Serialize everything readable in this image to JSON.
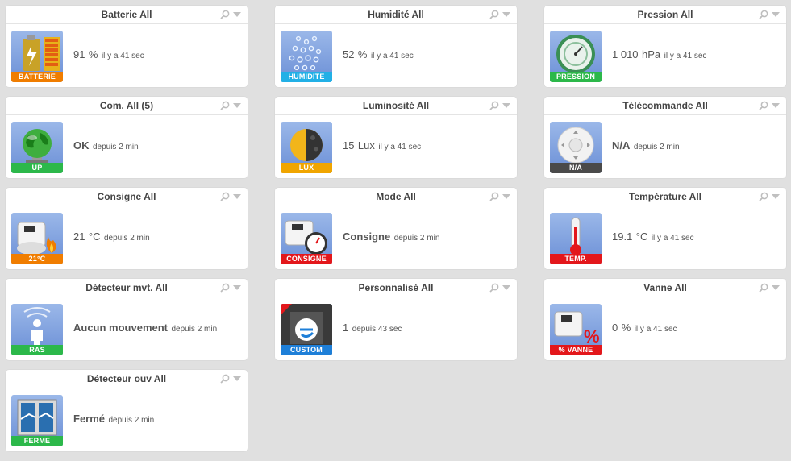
{
  "cards": [
    {
      "title": "Batterie All",
      "icon": "battery-icon",
      "label": "BATTERIE",
      "label_color": "#f07d00",
      "value": "91",
      "unit": "%",
      "since": "il y a 41 sec",
      "bold": false
    },
    {
      "title": "Humidité All",
      "icon": "humidity-icon",
      "label": "HUMIDITE",
      "label_color": "#22b0e6",
      "value": "52",
      "unit": "%",
      "since": "il y a 41 sec",
      "bold": false
    },
    {
      "title": "Pression All",
      "icon": "pressure-icon",
      "label": "PRESSION",
      "label_color": "#2cb84a",
      "value": "1 010",
      "unit": "hPa",
      "since": "il y a 41 sec",
      "bold": false
    },
    {
      "title": "Com. All (5)",
      "icon": "globe-icon",
      "label": "UP",
      "label_color": "#2cb84a",
      "value": "OK",
      "unit": "",
      "since": "depuis 2 min",
      "bold": true
    },
    {
      "title": "Luminosité All",
      "icon": "moon-icon",
      "label": "LUX",
      "label_color": "#f0a500",
      "value": "15",
      "unit": "Lux",
      "since": "il y a 41 sec",
      "bold": false
    },
    {
      "title": "Télécommande All",
      "icon": "remote-icon",
      "label": "N/A",
      "label_color": "#4a4a4a",
      "value": "N/A",
      "unit": "",
      "since": "depuis 2 min",
      "bold": true
    },
    {
      "title": "Consigne All",
      "icon": "thermostat-flame-icon",
      "label": "21°C",
      "label_color": "#f07d00",
      "value": "21",
      "unit": "°C",
      "since": "depuis 2 min",
      "bold": false
    },
    {
      "title": "Mode All",
      "icon": "thermostat-gauge-icon",
      "label": "CONSIGNE",
      "label_color": "#e3171b",
      "value": "Consigne",
      "unit": "",
      "since": "depuis 2 min",
      "bold": true
    },
    {
      "title": "Température All",
      "icon": "thermometer-icon",
      "label": "TEMP.",
      "label_color": "#e3171b",
      "value": "19.1",
      "unit": "°C",
      "since": "il y a 41 sec",
      "bold": false
    },
    {
      "title": "Détecteur mvt. All",
      "icon": "motion-person-icon",
      "label": "RAS",
      "label_color": "#2cb84a",
      "value": "Aucun mouvement",
      "unit": "",
      "since": "depuis 2 min",
      "bold": true
    },
    {
      "title": "Personnalisé All",
      "icon": "custom-logo-icon",
      "label": "CUSTOM",
      "label_color": "#1e7fd8",
      "value": "1",
      "unit": "",
      "since": "depuis 43 sec",
      "bold": false
    },
    {
      "title": "Vanne All",
      "icon": "valve-percent-icon",
      "label": "% VANNE",
      "label_color": "#e3171b",
      "value": "0",
      "unit": "%",
      "since": "il y a 41 sec",
      "bold": false
    },
    {
      "title": "Détecteur ouv All",
      "icon": "window-icon",
      "label": "FERME",
      "label_color": "#2cb84a",
      "value": "Fermé",
      "unit": "",
      "since": "depuis 2 min",
      "bold": true
    }
  ]
}
